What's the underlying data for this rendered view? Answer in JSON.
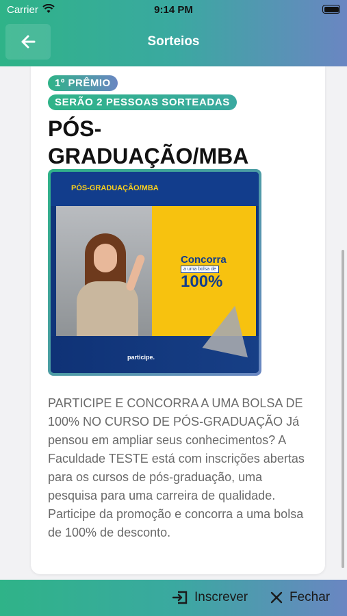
{
  "status_bar": {
    "carrier": "Carrier",
    "time": "9:14 PM"
  },
  "header": {
    "title": "Sorteios",
    "back_icon": "arrow-left-icon"
  },
  "prize": {
    "rank_label": "1º PRÊMIO",
    "winners_label": "SERÃO 2 PESSOAS SORTEADAS",
    "title": "PÓS-GRADUAÇÃO/MBA",
    "image": {
      "heading": "PÓS-GRADUAÇÃO/MBA",
      "concorra": "Concorra",
      "bolsa": "a uma bolsa de",
      "percent": "100%",
      "participe": "participe."
    },
    "description": "PARTICIPE E CONCORRA A UMA BOLSA DE 100% NO CURSO DE PÓS-GRADUAÇÃO Já pensou em ampliar seus conhecimentos? A Faculdade TESTE está com inscrições abertas para os cursos de pós-graduação, uma pesquisa para uma carreira de qualidade. Participe da promoção e concorra a uma bolsa de 100% de desconto."
  },
  "actions": {
    "subscribe_label": "Inscrever",
    "subscribe_icon": "sign-in-icon",
    "close_label": "Fechar",
    "close_icon": "close-icon"
  },
  "colors": {
    "gradient_start": "#2fb388",
    "gradient_end": "#6a86c2"
  }
}
